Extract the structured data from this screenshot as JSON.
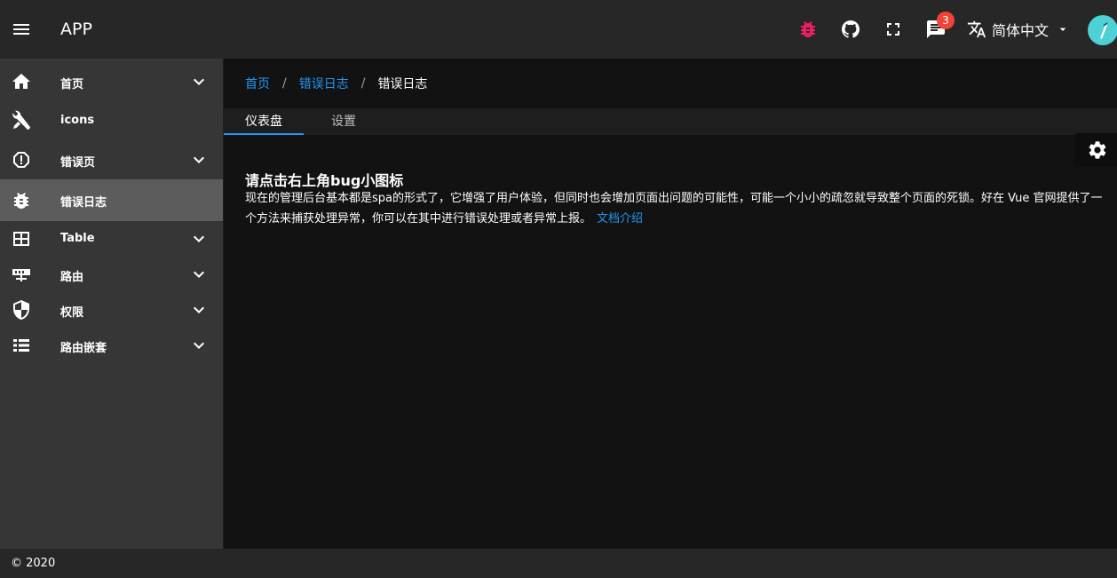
{
  "app": {
    "title": "APP"
  },
  "toolbar": {
    "icons": [
      "bug-icon",
      "github-icon",
      "fullscreen-icon",
      "message-icon",
      "translate-icon"
    ],
    "bug_color": "#e91e63",
    "message_badge": "3",
    "language": "简体中文"
  },
  "sidebar": {
    "items": [
      {
        "label": "首页",
        "icon": "home-icon",
        "expandable": true
      },
      {
        "label": "icons",
        "icon": "tools-icon",
        "expandable": false
      },
      {
        "label": "错误页",
        "icon": "alert-icon",
        "expandable": true
      },
      {
        "label": "错误日志",
        "icon": "bug-icon",
        "expandable": false,
        "active": true
      },
      {
        "label": "Table",
        "icon": "table-icon",
        "expandable": true
      },
      {
        "label": "路由",
        "icon": "router-icon",
        "expandable": true
      },
      {
        "label": "权限",
        "icon": "shield-icon",
        "expandable": true
      },
      {
        "label": "路由嵌套",
        "icon": "list-icon",
        "expandable": true
      }
    ]
  },
  "breadcrumb": {
    "items": [
      "首页",
      "错误日志",
      "错误日志"
    ],
    "separator": "/"
  },
  "tabs": [
    {
      "label": "仪表盘",
      "active": true
    },
    {
      "label": "设置",
      "active": false
    }
  ],
  "content": {
    "title": "请点击右上角bug小图标",
    "text": "现在的管理后台基本都是spa的形式了，它增强了用户体验，但同时也会增加页面出问题的可能性，可能一个小小的疏忽就导致整个页面的死锁。好在 Vue 官网提供了一个方法来捕获处理异常，你可以在其中进行错误处理或者异常上报。",
    "link": "文档介绍"
  },
  "footer": {
    "text": "© 2020"
  },
  "colors": {
    "accent": "#2196f3",
    "badge": "#f44336",
    "avatar": "#4dd0d6"
  }
}
